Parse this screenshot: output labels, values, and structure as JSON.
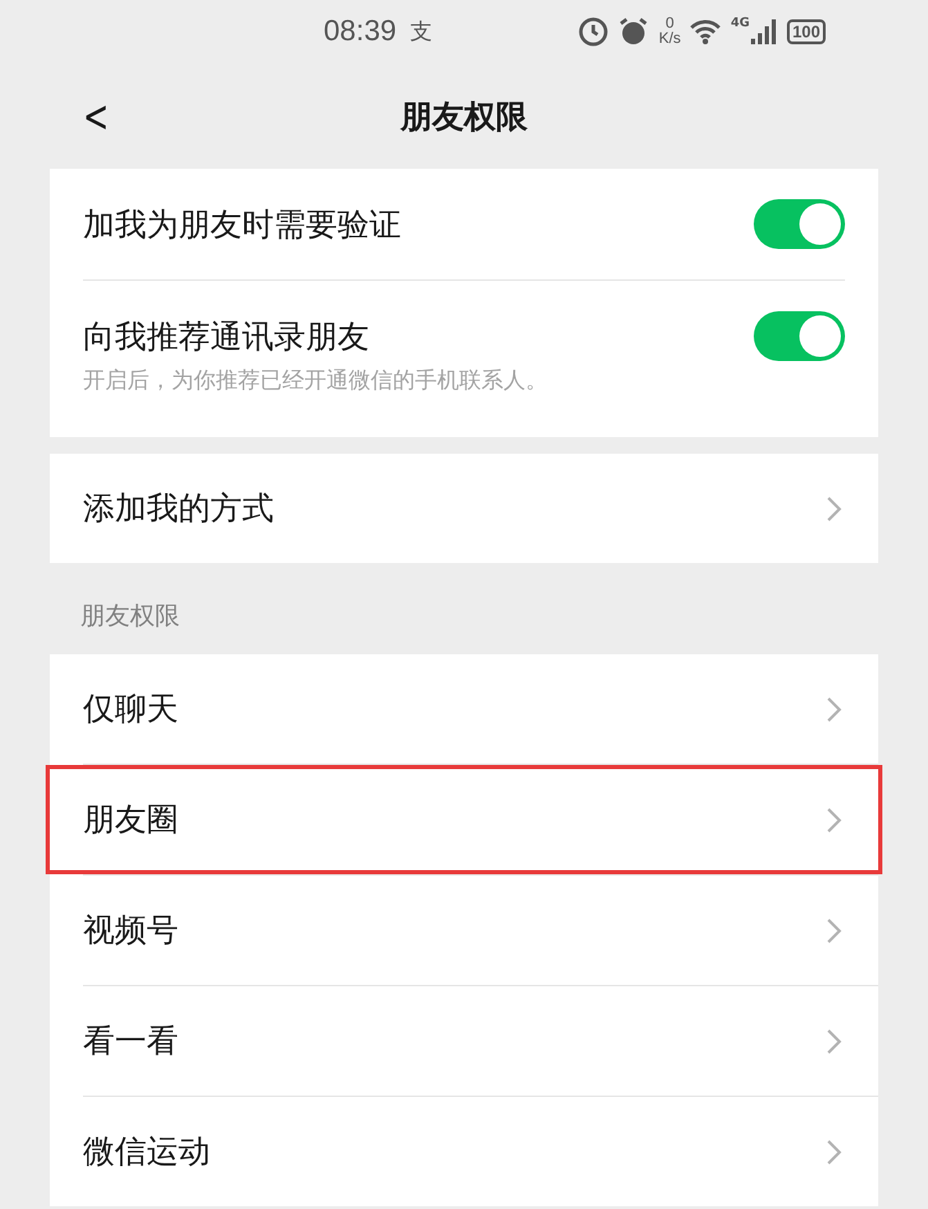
{
  "status_bar": {
    "time": "08:39",
    "notification": "支",
    "speed_value": "0",
    "speed_unit": "K/s",
    "network": "4G",
    "battery": "100"
  },
  "nav_bar": {
    "back": "<",
    "title": "朋友权限"
  },
  "toggles": [
    {
      "label": "加我为朋友时需要验证",
      "on": true
    },
    {
      "label": "向我推荐通讯录朋友",
      "on": true,
      "hint": "开启后，为你推荐已经开通微信的手机联系人。"
    }
  ],
  "add_methods": {
    "label": "添加我的方式"
  },
  "section": {
    "title": "朋友权限",
    "items": [
      {
        "label": "仅聊天",
        "highlighted": false
      },
      {
        "label": "朋友圈",
        "highlighted": true
      },
      {
        "label": "视频号",
        "highlighted": false
      },
      {
        "label": "看一看",
        "highlighted": false
      },
      {
        "label": "微信运动",
        "highlighted": false
      }
    ]
  }
}
